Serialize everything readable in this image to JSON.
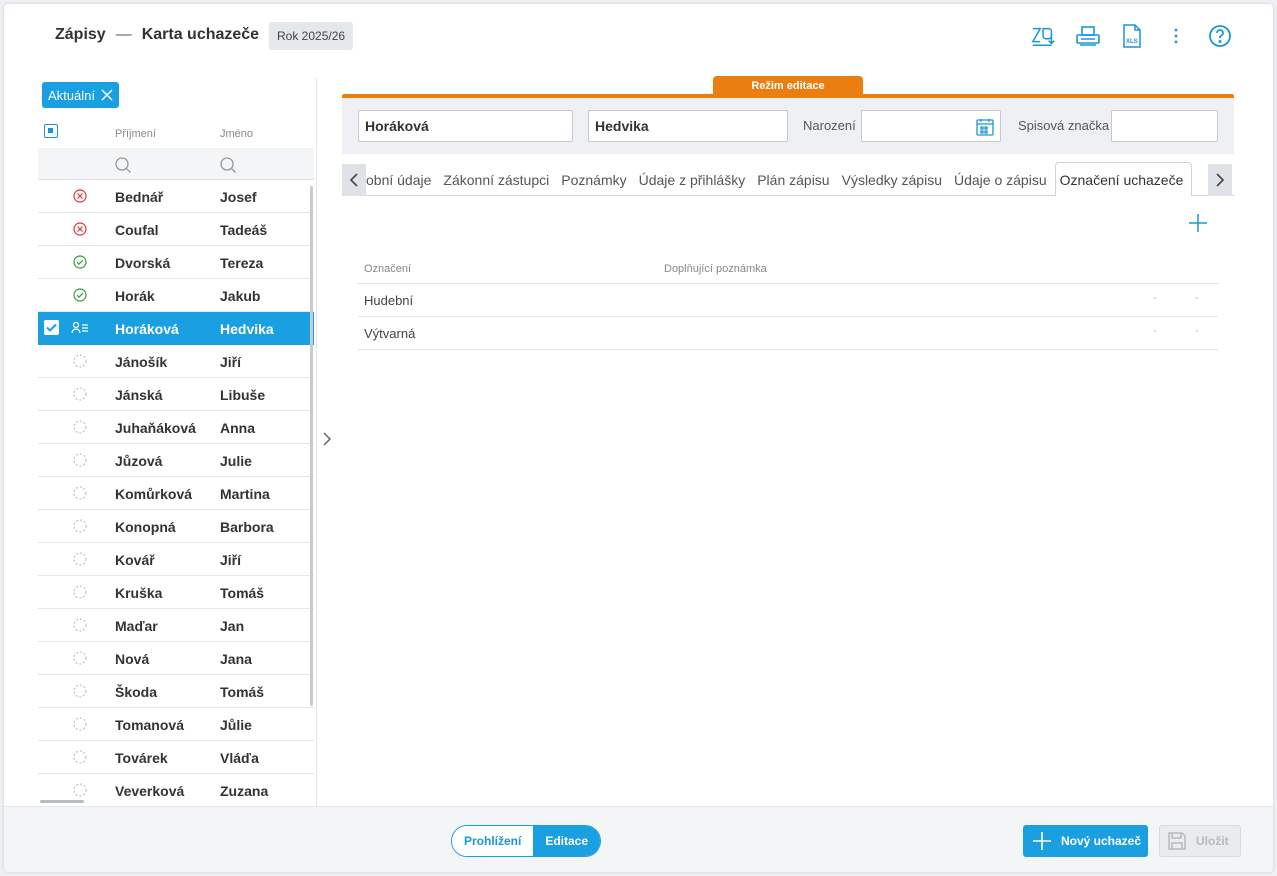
{
  "header": {
    "module": "Zápisy",
    "separator": "—",
    "title": "Karta uchazeče",
    "year": "Rok 2025/26",
    "icons": [
      "export-icon",
      "print-icon",
      "xls-icon",
      "more-icon",
      "help-icon"
    ],
    "xls_label": "XLS"
  },
  "filter_chip": {
    "label": "Aktuální"
  },
  "list": {
    "col_surname": "Příjmení",
    "col_name": "Jméno",
    "rows": [
      {
        "surname": "Bednář",
        "name": "Josef",
        "status": "rejected"
      },
      {
        "surname": "Coufal",
        "name": "Tadeáš",
        "status": "rejected"
      },
      {
        "surname": "Dvorská",
        "name": "Tereza",
        "status": "accepted"
      },
      {
        "surname": "Horák",
        "name": "Jakub",
        "status": "accepted"
      },
      {
        "surname": "Horáková",
        "name": "Hedvika",
        "status": "selected"
      },
      {
        "surname": "Jánošík",
        "name": "Jiří",
        "status": "pending"
      },
      {
        "surname": "Jánská",
        "name": "Libuše",
        "status": "pending"
      },
      {
        "surname": "Juhaňáková",
        "name": "Anna",
        "status": "pending"
      },
      {
        "surname": "Jůzová",
        "name": "Julie",
        "status": "pending"
      },
      {
        "surname": "Komůrková",
        "name": "Martina",
        "status": "pending"
      },
      {
        "surname": "Konopná",
        "name": "Barbora",
        "status": "pending"
      },
      {
        "surname": "Kovář",
        "name": "Jiří",
        "status": "pending"
      },
      {
        "surname": "Kruška",
        "name": "Tomáš",
        "status": "pending"
      },
      {
        "surname": "Maďar",
        "name": "Jan",
        "status": "pending"
      },
      {
        "surname": "Nová",
        "name": "Jana",
        "status": "pending"
      },
      {
        "surname": "Škoda",
        "name": "Tomáš",
        "status": "pending"
      },
      {
        "surname": "Tomanová",
        "name": "Jůlie",
        "status": "pending"
      },
      {
        "surname": "Továrek",
        "name": "Vláďa",
        "status": "pending"
      },
      {
        "surname": "Veverková",
        "name": "Zuzana",
        "status": "pending"
      }
    ]
  },
  "edit_mode_label": "Režim editace",
  "form": {
    "surname": "Horáková",
    "name": "Hedvika",
    "birth_label": "Narození",
    "birth_value": "",
    "file_label": "Spisová značka",
    "file_value": ""
  },
  "tabs": [
    {
      "label": "obní údaje",
      "active": false
    },
    {
      "label": "Zákonní zástupci",
      "active": false
    },
    {
      "label": "Poznámky",
      "active": false
    },
    {
      "label": "Údaje z přihlášky",
      "active": false
    },
    {
      "label": "Plán zápisu",
      "active": false
    },
    {
      "label": "Výsledky zápisu",
      "active": false
    },
    {
      "label": "Údaje o zápisu",
      "active": false
    },
    {
      "label": "Označení uchazeče",
      "active": true
    }
  ],
  "grid": {
    "col_mark": "Označení",
    "col_note": "Doplňující poznámka",
    "rows": [
      {
        "mark": "Hudební",
        "d1": "-",
        "d2": "-"
      },
      {
        "mark": "Výtvarná",
        "d1": "-",
        "d2": "-"
      }
    ]
  },
  "footer": {
    "mode_view": "Prohlížení",
    "mode_edit": "Editace",
    "new_label": "Nový uchazeč",
    "save_label": "Uložit"
  },
  "colors": {
    "accent": "#1a9fe0",
    "edit": "#ea7e10",
    "rejected": "#e0323c",
    "accepted": "#3a9a3a"
  }
}
